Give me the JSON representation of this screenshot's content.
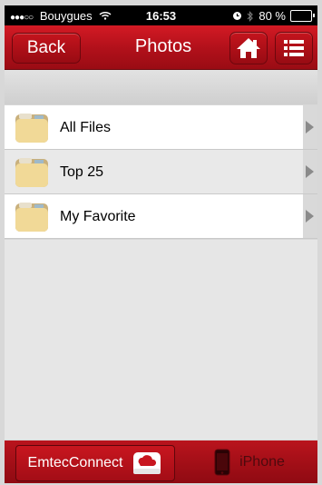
{
  "status_bar": {
    "carrier": "Bouygues",
    "time": "16:53",
    "battery_text": "80 %",
    "battery_level": 0.8
  },
  "nav_bar": {
    "back_label": "Back",
    "title": "Photos",
    "home_icon": "home-icon",
    "menu_icon": "list-menu-icon"
  },
  "folders": [
    {
      "label": "All Files",
      "icon": "folder-icon"
    },
    {
      "label": "Top 25",
      "icon": "folder-icon"
    },
    {
      "label": "My Favorite",
      "icon": "folder-icon"
    }
  ],
  "tab_bar": {
    "tabs": [
      {
        "label": "EmtecConnect",
        "icon": "cloud-drive-icon",
        "active": true
      },
      {
        "label": "iPhone",
        "icon": "iphone-icon",
        "active": false
      }
    ]
  },
  "colors": {
    "accent": "#b0101a",
    "accent_dark": "#6d070d"
  }
}
